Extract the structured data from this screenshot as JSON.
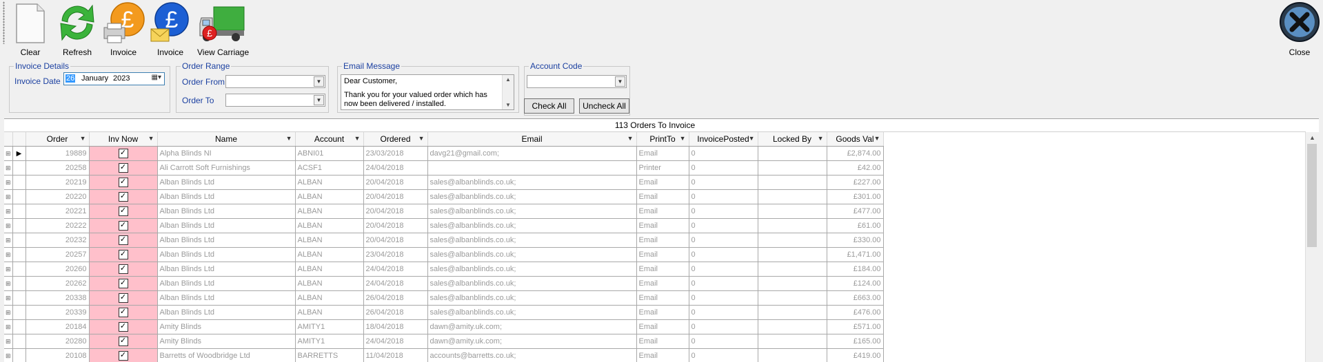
{
  "toolbar": {
    "clear_label": "Clear",
    "refresh_label": "Refresh",
    "invoice_print_label": "Invoice",
    "invoice_email_label": "Invoice",
    "view_carriage_label": "View Carriage",
    "close_label": "Close"
  },
  "invoice_details": {
    "legend": "Invoice Details",
    "date_label": "Invoice Date",
    "day": "26",
    "month": "January",
    "year": "2023"
  },
  "order_range": {
    "legend": "Order Range",
    "from_label": "Order From",
    "to_label": "Order To",
    "from_value": "",
    "to_value": ""
  },
  "email_message": {
    "legend": "Email Message",
    "line1": "Dear Customer,",
    "line2": "Thank you for your valued order which has",
    "line3": "now been delivered / installed."
  },
  "account_code": {
    "legend": "Account Code",
    "value": "",
    "check_all": "Check All",
    "uncheck_all": "Uncheck All"
  },
  "grid": {
    "title": "113 Orders To Invoice",
    "columns": [
      "Order",
      "Inv Now",
      "Name",
      "Account",
      "Ordered",
      "Email",
      "PrintTo",
      "InvoicePosted",
      "Locked By",
      "Goods Val"
    ],
    "rows": [
      {
        "order": "19889",
        "name": "Alpha Blinds NI",
        "account": "ABNI01",
        "ordered": "23/03/2018",
        "email": "davg21@gmail.com;",
        "printto": "Email",
        "posted": "0",
        "locked": "",
        "goods": "£2,874.00"
      },
      {
        "order": "20258",
        "name": "Ali Carrott Soft Furnishings",
        "account": "ACSF1",
        "ordered": "24/04/2018",
        "email": "",
        "printto": "Printer",
        "posted": "0",
        "locked": "",
        "goods": "£42.00"
      },
      {
        "order": "20219",
        "name": "Alban Blinds Ltd",
        "account": "ALBAN",
        "ordered": "20/04/2018",
        "email": "sales@albanblinds.co.uk;",
        "printto": "Email",
        "posted": "0",
        "locked": "",
        "goods": "£227.00"
      },
      {
        "order": "20220",
        "name": "Alban Blinds Ltd",
        "account": "ALBAN",
        "ordered": "20/04/2018",
        "email": "sales@albanblinds.co.uk;",
        "printto": "Email",
        "posted": "0",
        "locked": "",
        "goods": "£301.00"
      },
      {
        "order": "20221",
        "name": "Alban Blinds Ltd",
        "account": "ALBAN",
        "ordered": "20/04/2018",
        "email": "sales@albanblinds.co.uk;",
        "printto": "Email",
        "posted": "0",
        "locked": "",
        "goods": "£477.00"
      },
      {
        "order": "20222",
        "name": "Alban Blinds Ltd",
        "account": "ALBAN",
        "ordered": "20/04/2018",
        "email": "sales@albanblinds.co.uk;",
        "printto": "Email",
        "posted": "0",
        "locked": "",
        "goods": "£61.00"
      },
      {
        "order": "20232",
        "name": "Alban Blinds Ltd",
        "account": "ALBAN",
        "ordered": "20/04/2018",
        "email": "sales@albanblinds.co.uk;",
        "printto": "Email",
        "posted": "0",
        "locked": "",
        "goods": "£330.00"
      },
      {
        "order": "20257",
        "name": "Alban Blinds Ltd",
        "account": "ALBAN",
        "ordered": "23/04/2018",
        "email": "sales@albanblinds.co.uk;",
        "printto": "Email",
        "posted": "0",
        "locked": "",
        "goods": "£1,471.00"
      },
      {
        "order": "20260",
        "name": "Alban Blinds Ltd",
        "account": "ALBAN",
        "ordered": "24/04/2018",
        "email": "sales@albanblinds.co.uk;",
        "printto": "Email",
        "posted": "0",
        "locked": "",
        "goods": "£184.00"
      },
      {
        "order": "20262",
        "name": "Alban Blinds Ltd",
        "account": "ALBAN",
        "ordered": "24/04/2018",
        "email": "sales@albanblinds.co.uk;",
        "printto": "Email",
        "posted": "0",
        "locked": "",
        "goods": "£124.00"
      },
      {
        "order": "20338",
        "name": "Alban Blinds Ltd",
        "account": "ALBAN",
        "ordered": "26/04/2018",
        "email": "sales@albanblinds.co.uk;",
        "printto": "Email",
        "posted": "0",
        "locked": "",
        "goods": "£663.00"
      },
      {
        "order": "20339",
        "name": "Alban Blinds Ltd",
        "account": "ALBAN",
        "ordered": "26/04/2018",
        "email": "sales@albanblinds.co.uk;",
        "printto": "Email",
        "posted": "0",
        "locked": "",
        "goods": "£476.00"
      },
      {
        "order": "20184",
        "name": "Amity Blinds",
        "account": "AMITY1",
        "ordered": "18/04/2018",
        "email": "dawn@amity.uk.com;",
        "printto": "Email",
        "posted": "0",
        "locked": "",
        "goods": "£571.00"
      },
      {
        "order": "20280",
        "name": "Amity Blinds",
        "account": "AMITY1",
        "ordered": "24/04/2018",
        "email": "dawn@amity.uk.com;",
        "printto": "Email",
        "posted": "0",
        "locked": "",
        "goods": "£165.00"
      },
      {
        "order": "20108",
        "name": "Barretts of Woodbridge Ltd",
        "account": "BARRETTS",
        "ordered": "11/04/2018",
        "email": "accounts@barretts.co.uk;",
        "printto": "Email",
        "posted": "0",
        "locked": "",
        "goods": "£419.00"
      }
    ]
  }
}
